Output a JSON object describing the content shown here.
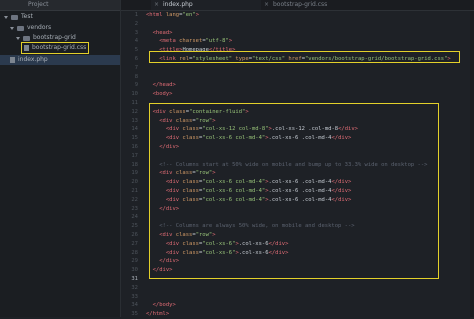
{
  "sidebar": {
    "header": "Project",
    "tree": [
      {
        "label": "Test",
        "kind": "folder"
      },
      {
        "label": "vendors",
        "kind": "folder"
      },
      {
        "label": "bootstrap-grid",
        "kind": "folder"
      },
      {
        "label": "bootstrap-grid.css",
        "kind": "file"
      },
      {
        "label": "index.php",
        "kind": "file"
      }
    ]
  },
  "tabs": [
    {
      "label": "index.php",
      "active": true
    },
    {
      "label": "bootstrap-grid.css",
      "active": false
    }
  ],
  "editor": {
    "line_numbers": [
      "1",
      "2",
      "3",
      "4",
      "5",
      "6",
      "7",
      "8",
      "9",
      "10",
      "11",
      "12",
      "13",
      "14",
      "15",
      "16",
      "17",
      "18",
      "19",
      "20",
      "21",
      "22",
      "23",
      "24",
      "25",
      "26",
      "27",
      "28",
      "29",
      "30",
      "31",
      "32",
      "33",
      "34",
      "35"
    ],
    "current_line": "31",
    "lines": [
      [
        [
          "tag",
          "<html"
        ],
        [
          "attr",
          " lang"
        ],
        [
          "txt",
          "="
        ],
        [
          "str",
          "\"en\""
        ],
        [
          "tag",
          ">"
        ]
      ],
      [],
      [
        [
          "tag",
          "  <head>"
        ]
      ],
      [
        [
          "tag",
          "    <meta"
        ],
        [
          "attr",
          " charset"
        ],
        [
          "txt",
          "="
        ],
        [
          "str",
          "\"utf-8\""
        ],
        [
          "tag",
          ">"
        ]
      ],
      [
        [
          "tag",
          "    <title>"
        ],
        [
          "txt",
          "Homepage"
        ],
        [
          "tag",
          "</title>"
        ]
      ],
      [
        [
          "tag",
          "    <link"
        ],
        [
          "attr",
          " rel"
        ],
        [
          "txt",
          "="
        ],
        [
          "str",
          "\"stylesheet\""
        ],
        [
          "attr",
          " type"
        ],
        [
          "txt",
          "="
        ],
        [
          "str",
          "\"text/css\""
        ],
        [
          "attr",
          " href"
        ],
        [
          "txt",
          "="
        ],
        [
          "str",
          "\"vendors/bootstrap-grid/bootstrap-grid.css\""
        ],
        [
          "tag",
          ">"
        ]
      ],
      [],
      [],
      [
        [
          "tag",
          "  </head>"
        ]
      ],
      [
        [
          "tag",
          "  <body>"
        ]
      ],
      [],
      [
        [
          "tag",
          "  <div"
        ],
        [
          "attr",
          " class"
        ],
        [
          "txt",
          "="
        ],
        [
          "str",
          "\"container-fluid\""
        ],
        [
          "tag",
          ">"
        ]
      ],
      [
        [
          "tag",
          "    <div"
        ],
        [
          "attr",
          " class"
        ],
        [
          "txt",
          "="
        ],
        [
          "str",
          "\"row\""
        ],
        [
          "tag",
          ">"
        ]
      ],
      [
        [
          "tag",
          "      <div"
        ],
        [
          "attr",
          " class"
        ],
        [
          "txt",
          "="
        ],
        [
          "str",
          "\"col-xs-12 col-md-8\""
        ],
        [
          "tag",
          ">"
        ],
        [
          "txt",
          ".col-xs-12 .col-md-8"
        ],
        [
          "tag",
          "</div>"
        ]
      ],
      [
        [
          "tag",
          "      <div"
        ],
        [
          "attr",
          " class"
        ],
        [
          "txt",
          "="
        ],
        [
          "str",
          "\"col-xs-6 col-md-4\""
        ],
        [
          "tag",
          ">"
        ],
        [
          "txt",
          ".col-xs-6 .col-md-4"
        ],
        [
          "tag",
          "</div>"
        ]
      ],
      [
        [
          "tag",
          "    </div>"
        ]
      ],
      [],
      [
        [
          "cmt",
          "    <!-- Columns start at 50% wide on mobile and bump up to 33.3% wide on desktop -->"
        ]
      ],
      [
        [
          "tag",
          "    <div"
        ],
        [
          "attr",
          " class"
        ],
        [
          "txt",
          "="
        ],
        [
          "str",
          "\"row\""
        ],
        [
          "tag",
          ">"
        ]
      ],
      [
        [
          "tag",
          "      <div"
        ],
        [
          "attr",
          " class"
        ],
        [
          "txt",
          "="
        ],
        [
          "str",
          "\"col-xs-6 col-md-4\""
        ],
        [
          "tag",
          ">"
        ],
        [
          "txt",
          ".col-xs-6 .col-md-4"
        ],
        [
          "tag",
          "</div>"
        ]
      ],
      [
        [
          "tag",
          "      <div"
        ],
        [
          "attr",
          " class"
        ],
        [
          "txt",
          "="
        ],
        [
          "str",
          "\"col-xs-6 col-md-4\""
        ],
        [
          "tag",
          ">"
        ],
        [
          "txt",
          ".col-xs-6 .col-md-4"
        ],
        [
          "tag",
          "</div>"
        ]
      ],
      [
        [
          "tag",
          "      <div"
        ],
        [
          "attr",
          " class"
        ],
        [
          "txt",
          "="
        ],
        [
          "str",
          "\"col-xs-6 col-md-4\""
        ],
        [
          "tag",
          ">"
        ],
        [
          "txt",
          ".col-xs-6 .col-md-4"
        ],
        [
          "tag",
          "</div>"
        ]
      ],
      [
        [
          "tag",
          "    </div>"
        ]
      ],
      [],
      [
        [
          "cmt",
          "    <!-- Columns are always 50% wide, on mobile and desktop -->"
        ]
      ],
      [
        [
          "tag",
          "    <div"
        ],
        [
          "attr",
          " class"
        ],
        [
          "txt",
          "="
        ],
        [
          "str",
          "\"row\""
        ],
        [
          "tag",
          ">"
        ]
      ],
      [
        [
          "tag",
          "      <div"
        ],
        [
          "attr",
          " class"
        ],
        [
          "txt",
          "="
        ],
        [
          "str",
          "\"col-xs-6\""
        ],
        [
          "tag",
          ">"
        ],
        [
          "txt",
          ".col-xs-6"
        ],
        [
          "tag",
          "</div>"
        ]
      ],
      [
        [
          "tag",
          "      <div"
        ],
        [
          "attr",
          " class"
        ],
        [
          "txt",
          "="
        ],
        [
          "str",
          "\"col-xs-6\""
        ],
        [
          "tag",
          ">"
        ],
        [
          "txt",
          ".col-xs-6"
        ],
        [
          "tag",
          "</div>"
        ]
      ],
      [
        [
          "tag",
          "    </div>"
        ]
      ],
      [
        [
          "tag",
          "  </div>"
        ]
      ],
      [],
      [],
      [],
      [
        [
          "tag",
          "  </body>"
        ]
      ],
      [
        [
          "tag",
          "</html>"
        ]
      ]
    ]
  },
  "colors": {
    "highlight": "#e3d02a",
    "tag": "#e06c75",
    "attr": "#d19a66",
    "string": "#98c379"
  }
}
